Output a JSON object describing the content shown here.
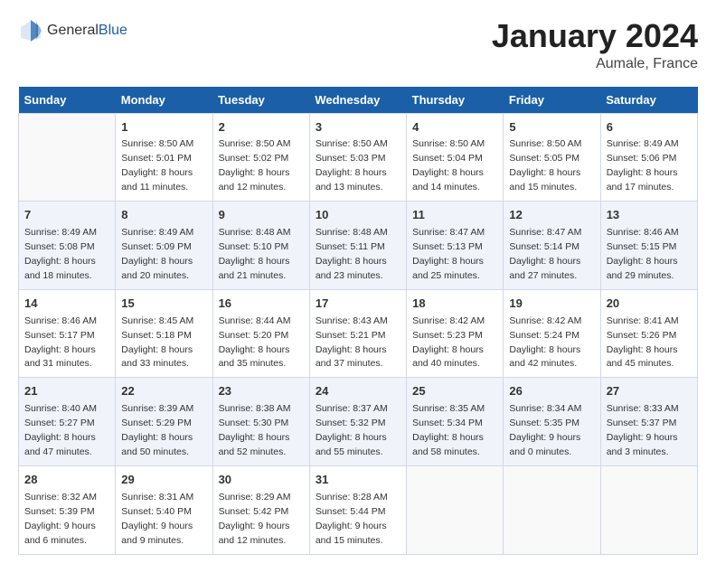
{
  "header": {
    "logo_general": "General",
    "logo_blue": "Blue",
    "month_title": "January 2024",
    "location": "Aumale, France"
  },
  "days_of_week": [
    "Sunday",
    "Monday",
    "Tuesday",
    "Wednesday",
    "Thursday",
    "Friday",
    "Saturday"
  ],
  "weeks": [
    [
      {
        "num": "",
        "sunrise": "",
        "sunset": "",
        "daylight": ""
      },
      {
        "num": "1",
        "sunrise": "Sunrise: 8:50 AM",
        "sunset": "Sunset: 5:01 PM",
        "daylight": "Daylight: 8 hours and 11 minutes."
      },
      {
        "num": "2",
        "sunrise": "Sunrise: 8:50 AM",
        "sunset": "Sunset: 5:02 PM",
        "daylight": "Daylight: 8 hours and 12 minutes."
      },
      {
        "num": "3",
        "sunrise": "Sunrise: 8:50 AM",
        "sunset": "Sunset: 5:03 PM",
        "daylight": "Daylight: 8 hours and 13 minutes."
      },
      {
        "num": "4",
        "sunrise": "Sunrise: 8:50 AM",
        "sunset": "Sunset: 5:04 PM",
        "daylight": "Daylight: 8 hours and 14 minutes."
      },
      {
        "num": "5",
        "sunrise": "Sunrise: 8:50 AM",
        "sunset": "Sunset: 5:05 PM",
        "daylight": "Daylight: 8 hours and 15 minutes."
      },
      {
        "num": "6",
        "sunrise": "Sunrise: 8:49 AM",
        "sunset": "Sunset: 5:06 PM",
        "daylight": "Daylight: 8 hours and 17 minutes."
      }
    ],
    [
      {
        "num": "7",
        "sunrise": "Sunrise: 8:49 AM",
        "sunset": "Sunset: 5:08 PM",
        "daylight": "Daylight: 8 hours and 18 minutes."
      },
      {
        "num": "8",
        "sunrise": "Sunrise: 8:49 AM",
        "sunset": "Sunset: 5:09 PM",
        "daylight": "Daylight: 8 hours and 20 minutes."
      },
      {
        "num": "9",
        "sunrise": "Sunrise: 8:48 AM",
        "sunset": "Sunset: 5:10 PM",
        "daylight": "Daylight: 8 hours and 21 minutes."
      },
      {
        "num": "10",
        "sunrise": "Sunrise: 8:48 AM",
        "sunset": "Sunset: 5:11 PM",
        "daylight": "Daylight: 8 hours and 23 minutes."
      },
      {
        "num": "11",
        "sunrise": "Sunrise: 8:47 AM",
        "sunset": "Sunset: 5:13 PM",
        "daylight": "Daylight: 8 hours and 25 minutes."
      },
      {
        "num": "12",
        "sunrise": "Sunrise: 8:47 AM",
        "sunset": "Sunset: 5:14 PM",
        "daylight": "Daylight: 8 hours and 27 minutes."
      },
      {
        "num": "13",
        "sunrise": "Sunrise: 8:46 AM",
        "sunset": "Sunset: 5:15 PM",
        "daylight": "Daylight: 8 hours and 29 minutes."
      }
    ],
    [
      {
        "num": "14",
        "sunrise": "Sunrise: 8:46 AM",
        "sunset": "Sunset: 5:17 PM",
        "daylight": "Daylight: 8 hours and 31 minutes."
      },
      {
        "num": "15",
        "sunrise": "Sunrise: 8:45 AM",
        "sunset": "Sunset: 5:18 PM",
        "daylight": "Daylight: 8 hours and 33 minutes."
      },
      {
        "num": "16",
        "sunrise": "Sunrise: 8:44 AM",
        "sunset": "Sunset: 5:20 PM",
        "daylight": "Daylight: 8 hours and 35 minutes."
      },
      {
        "num": "17",
        "sunrise": "Sunrise: 8:43 AM",
        "sunset": "Sunset: 5:21 PM",
        "daylight": "Daylight: 8 hours and 37 minutes."
      },
      {
        "num": "18",
        "sunrise": "Sunrise: 8:42 AM",
        "sunset": "Sunset: 5:23 PM",
        "daylight": "Daylight: 8 hours and 40 minutes."
      },
      {
        "num": "19",
        "sunrise": "Sunrise: 8:42 AM",
        "sunset": "Sunset: 5:24 PM",
        "daylight": "Daylight: 8 hours and 42 minutes."
      },
      {
        "num": "20",
        "sunrise": "Sunrise: 8:41 AM",
        "sunset": "Sunset: 5:26 PM",
        "daylight": "Daylight: 8 hours and 45 minutes."
      }
    ],
    [
      {
        "num": "21",
        "sunrise": "Sunrise: 8:40 AM",
        "sunset": "Sunset: 5:27 PM",
        "daylight": "Daylight: 8 hours and 47 minutes."
      },
      {
        "num": "22",
        "sunrise": "Sunrise: 8:39 AM",
        "sunset": "Sunset: 5:29 PM",
        "daylight": "Daylight: 8 hours and 50 minutes."
      },
      {
        "num": "23",
        "sunrise": "Sunrise: 8:38 AM",
        "sunset": "Sunset: 5:30 PM",
        "daylight": "Daylight: 8 hours and 52 minutes."
      },
      {
        "num": "24",
        "sunrise": "Sunrise: 8:37 AM",
        "sunset": "Sunset: 5:32 PM",
        "daylight": "Daylight: 8 hours and 55 minutes."
      },
      {
        "num": "25",
        "sunrise": "Sunrise: 8:35 AM",
        "sunset": "Sunset: 5:34 PM",
        "daylight": "Daylight: 8 hours and 58 minutes."
      },
      {
        "num": "26",
        "sunrise": "Sunrise: 8:34 AM",
        "sunset": "Sunset: 5:35 PM",
        "daylight": "Daylight: 9 hours and 0 minutes."
      },
      {
        "num": "27",
        "sunrise": "Sunrise: 8:33 AM",
        "sunset": "Sunset: 5:37 PM",
        "daylight": "Daylight: 9 hours and 3 minutes."
      }
    ],
    [
      {
        "num": "28",
        "sunrise": "Sunrise: 8:32 AM",
        "sunset": "Sunset: 5:39 PM",
        "daylight": "Daylight: 9 hours and 6 minutes."
      },
      {
        "num": "29",
        "sunrise": "Sunrise: 8:31 AM",
        "sunset": "Sunset: 5:40 PM",
        "daylight": "Daylight: 9 hours and 9 minutes."
      },
      {
        "num": "30",
        "sunrise": "Sunrise: 8:29 AM",
        "sunset": "Sunset: 5:42 PM",
        "daylight": "Daylight: 9 hours and 12 minutes."
      },
      {
        "num": "31",
        "sunrise": "Sunrise: 8:28 AM",
        "sunset": "Sunset: 5:44 PM",
        "daylight": "Daylight: 9 hours and 15 minutes."
      },
      {
        "num": "",
        "sunrise": "",
        "sunset": "",
        "daylight": ""
      },
      {
        "num": "",
        "sunrise": "",
        "sunset": "",
        "daylight": ""
      },
      {
        "num": "",
        "sunrise": "",
        "sunset": "",
        "daylight": ""
      }
    ]
  ]
}
